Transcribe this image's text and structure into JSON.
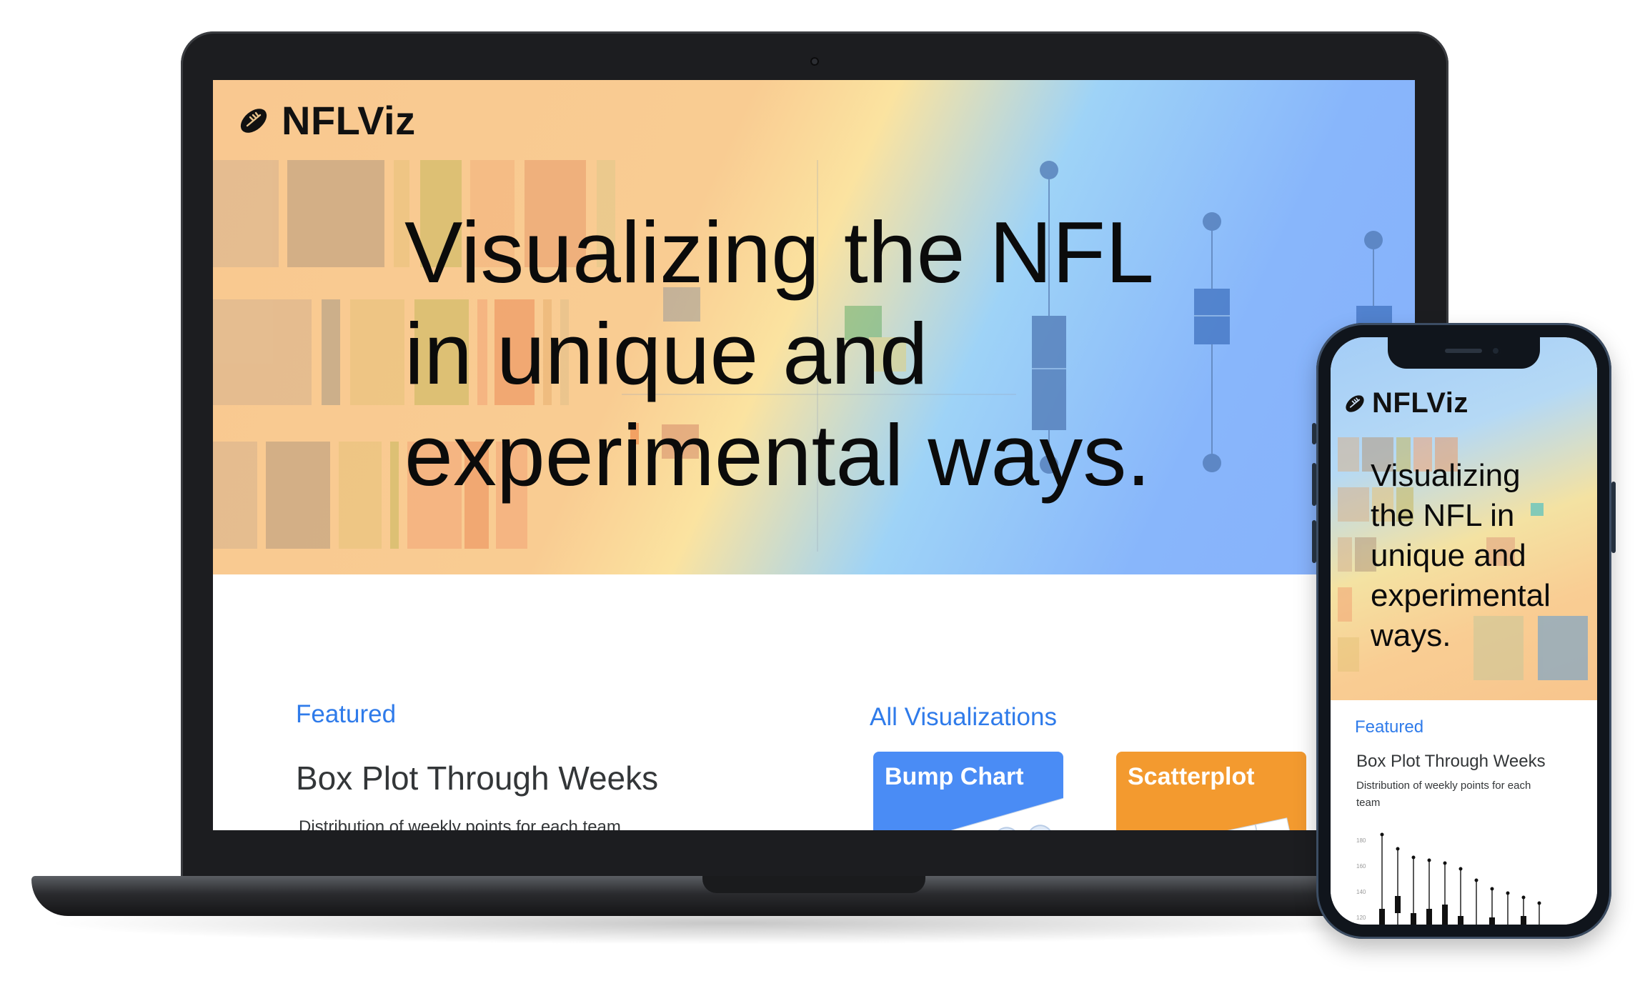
{
  "brand": {
    "name": "NFLViz"
  },
  "hero": {
    "title_lines": [
      "Visualizing the NFL",
      "in unique and",
      "experimental ways."
    ]
  },
  "featured": {
    "label": "Featured",
    "title": "Box Plot Through Weeks",
    "subtitle": "Distribution of weekly points for each team",
    "y_tick_top": "180"
  },
  "all_visualizations": {
    "label": "All Visualizations",
    "cards": [
      {
        "label": "Bump Chart",
        "color": "#4a8cf5"
      },
      {
        "label": "Scatterplot",
        "color": "#f39a2f"
      }
    ]
  },
  "phone": {
    "hero_lines": [
      "Visualizing",
      "the NFL in",
      "unique and",
      "experimental",
      "ways."
    ],
    "featured_label": "Featured",
    "featured_title": "Box Plot Through Weeks",
    "featured_subtitle_lines": [
      "Distribution of weekly points for each",
      "team"
    ],
    "y_ticks": [
      "180",
      "160",
      "140",
      "120"
    ]
  },
  "colors": {
    "accent": "#2f7bea",
    "bump_card": "#4a8cf5",
    "scatter_card": "#f39a2f"
  }
}
